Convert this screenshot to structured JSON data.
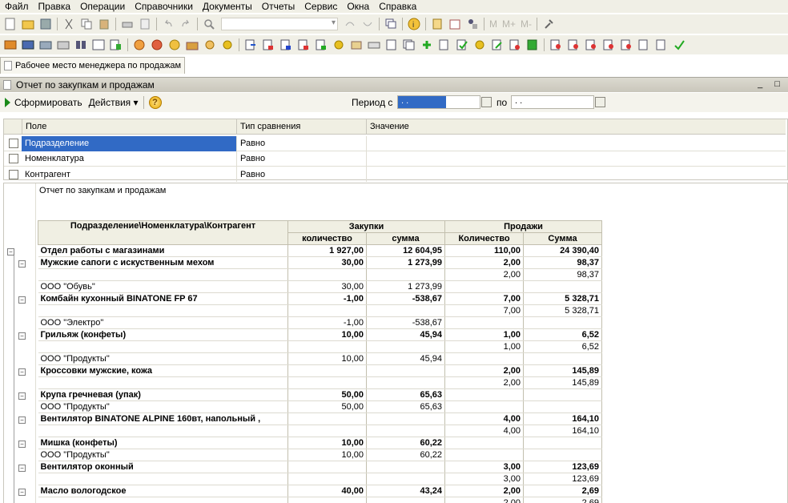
{
  "menu": [
    "Файл",
    "Правка",
    "Операции",
    "Справочники",
    "Документы",
    "Отчеты",
    "Сервис",
    "Окна",
    "Справка"
  ],
  "toolbar3_text": [
    "М",
    "М+",
    "М-"
  ],
  "tab": {
    "label": "Рабочее место менеджера по продажам"
  },
  "window": {
    "title": "Отчет по закупкам и продажам",
    "controls": "_ □"
  },
  "actions": {
    "generate": "Сформировать",
    "actions": "Действия",
    "period_label": "Период с",
    "period_to": "по",
    "period_from_value": "  .  .",
    "period_to_value": "  .  ."
  },
  "filters": {
    "headers": [
      "Поле",
      "Тип сравнения",
      "Значение"
    ],
    "rows": [
      {
        "field": "Подразделение",
        "type": "Равно",
        "value": ""
      },
      {
        "field": "Номенклатура",
        "type": "Равно",
        "value": ""
      },
      {
        "field": "Контрагент",
        "type": "Равно",
        "value": ""
      }
    ]
  },
  "report": {
    "title": "Отчет по закупкам и продажам",
    "col_group": "Подразделение\\Номенклатура\\Контрагент",
    "purchases": "Закупки",
    "sales": "Продажи",
    "sub": [
      "количество",
      "сумма",
      "Количество",
      "Сумма"
    ],
    "rows": [
      {
        "name": "Отдел работы с магазинами",
        "q1": "1 927,00",
        "s1": "12 604,95",
        "q2": "110,00",
        "s2": "24 390,40",
        "bold": true
      },
      {
        "name": "Мужские сапоги с искуственным мехом",
        "q1": "30,00",
        "s1": "1 273,99",
        "q2": "2,00",
        "s2": "98,37",
        "bold": true
      },
      {
        "name": "",
        "q1": "",
        "s1": "",
        "q2": "2,00",
        "s2": "98,37",
        "bold": false
      },
      {
        "name": "ООО \"Обувь\"",
        "q1": "30,00",
        "s1": "1 273,99",
        "q2": "",
        "s2": "",
        "bold": false
      },
      {
        "name": "Комбайн кухонный BINATONE FP 67",
        "q1": "-1,00",
        "s1": "-538,67",
        "q2": "7,00",
        "s2": "5 328,71",
        "bold": true
      },
      {
        "name": "",
        "q1": "",
        "s1": "",
        "q2": "7,00",
        "s2": "5 328,71",
        "bold": false
      },
      {
        "name": "ООО \"Электро\"",
        "q1": "-1,00",
        "s1": "-538,67",
        "q2": "",
        "s2": "",
        "bold": false
      },
      {
        "name": "Грильяж (конфеты)",
        "q1": "10,00",
        "s1": "45,94",
        "q2": "1,00",
        "s2": "6,52",
        "bold": true
      },
      {
        "name": "",
        "q1": "",
        "s1": "",
        "q2": "1,00",
        "s2": "6,52",
        "bold": false
      },
      {
        "name": "ООО \"Продукты\"",
        "q1": "10,00",
        "s1": "45,94",
        "q2": "",
        "s2": "",
        "bold": false
      },
      {
        "name": "Кроссовки мужские, кожа",
        "q1": "",
        "s1": "",
        "q2": "2,00",
        "s2": "145,89",
        "bold": true
      },
      {
        "name": "",
        "q1": "",
        "s1": "",
        "q2": "2,00",
        "s2": "145,89",
        "bold": false
      },
      {
        "name": "Крупа гречневая (упак)",
        "q1": "50,00",
        "s1": "65,63",
        "q2": "",
        "s2": "",
        "bold": true
      },
      {
        "name": "ООО \"Продукты\"",
        "q1": "50,00",
        "s1": "65,63",
        "q2": "",
        "s2": "",
        "bold": false
      },
      {
        "name": "Вентилятор BINATONE ALPINE 160вт, напольный ,",
        "q1": "",
        "s1": "",
        "q2": "4,00",
        "s2": "164,10",
        "bold": true
      },
      {
        "name": "",
        "q1": "",
        "s1": "",
        "q2": "4,00",
        "s2": "164,10",
        "bold": false
      },
      {
        "name": "Мишка (конфеты)",
        "q1": "10,00",
        "s1": "60,22",
        "q2": "",
        "s2": "",
        "bold": true
      },
      {
        "name": "ООО \"Продукты\"",
        "q1": "10,00",
        "s1": "60,22",
        "q2": "",
        "s2": "",
        "bold": false
      },
      {
        "name": "Вентилятор оконный",
        "q1": "",
        "s1": "",
        "q2": "3,00",
        "s2": "123,69",
        "bold": true
      },
      {
        "name": "",
        "q1": "",
        "s1": "",
        "q2": "3,00",
        "s2": "123,69",
        "bold": false
      },
      {
        "name": "Масло вологодское",
        "q1": "40,00",
        "s1": "43,24",
        "q2": "2,00",
        "s2": "2,69",
        "bold": true
      },
      {
        "name": "",
        "q1": "",
        "s1": "",
        "q2": "2,00",
        "s2": "2,69",
        "bold": false
      }
    ]
  }
}
